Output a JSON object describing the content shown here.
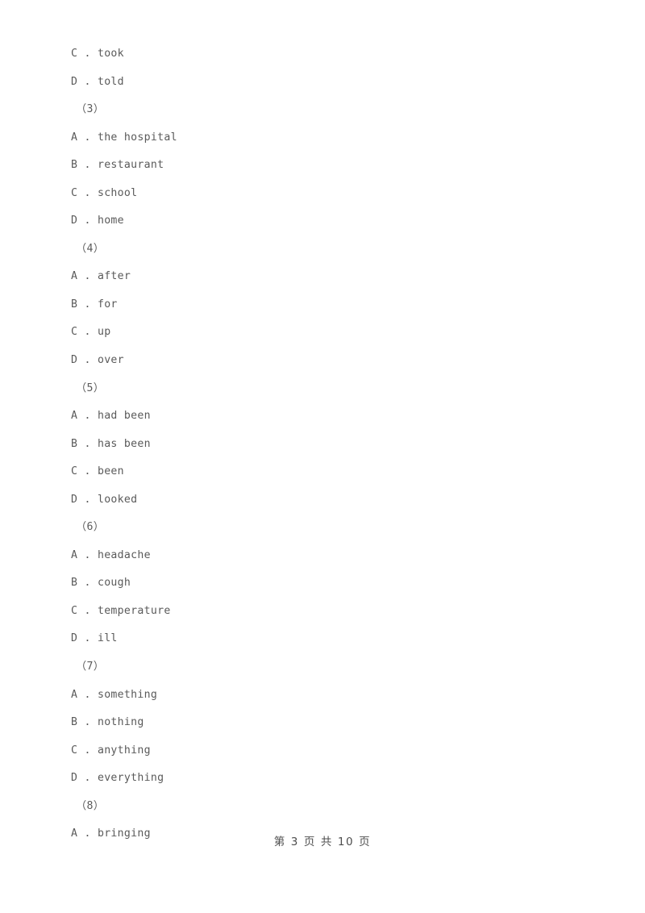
{
  "page": {
    "background_color": "#ffffff",
    "text_color": "#5a5a5a"
  },
  "lines": [
    {
      "type": "option",
      "text": "C . took"
    },
    {
      "type": "option",
      "text": "D . told"
    },
    {
      "type": "qnum",
      "text": "（3）"
    },
    {
      "type": "option",
      "text": "A . the hospital"
    },
    {
      "type": "option",
      "text": "B . restaurant"
    },
    {
      "type": "option",
      "text": "C . school"
    },
    {
      "type": "option",
      "text": "D . home"
    },
    {
      "type": "qnum",
      "text": "（4）"
    },
    {
      "type": "option",
      "text": "A . after"
    },
    {
      "type": "option",
      "text": "B . for"
    },
    {
      "type": "option",
      "text": "C . up"
    },
    {
      "type": "option",
      "text": "D . over"
    },
    {
      "type": "qnum",
      "text": "（5）"
    },
    {
      "type": "option",
      "text": "A . had been"
    },
    {
      "type": "option",
      "text": "B . has been"
    },
    {
      "type": "option",
      "text": "C . been"
    },
    {
      "type": "option",
      "text": "D . looked"
    },
    {
      "type": "qnum",
      "text": "（6）"
    },
    {
      "type": "option",
      "text": "A . headache"
    },
    {
      "type": "option",
      "text": "B . cough"
    },
    {
      "type": "option",
      "text": "C . temperature"
    },
    {
      "type": "option",
      "text": "D . ill"
    },
    {
      "type": "qnum",
      "text": "（7）"
    },
    {
      "type": "option",
      "text": "A . something"
    },
    {
      "type": "option",
      "text": "B . nothing"
    },
    {
      "type": "option",
      "text": "C . anything"
    },
    {
      "type": "option",
      "text": "D . everything"
    },
    {
      "type": "qnum",
      "text": "（8）"
    },
    {
      "type": "option",
      "text": "A . bringing"
    }
  ],
  "footer": {
    "text": "第 3 页 共 10 页",
    "current_page": "3",
    "total_pages": "10"
  }
}
